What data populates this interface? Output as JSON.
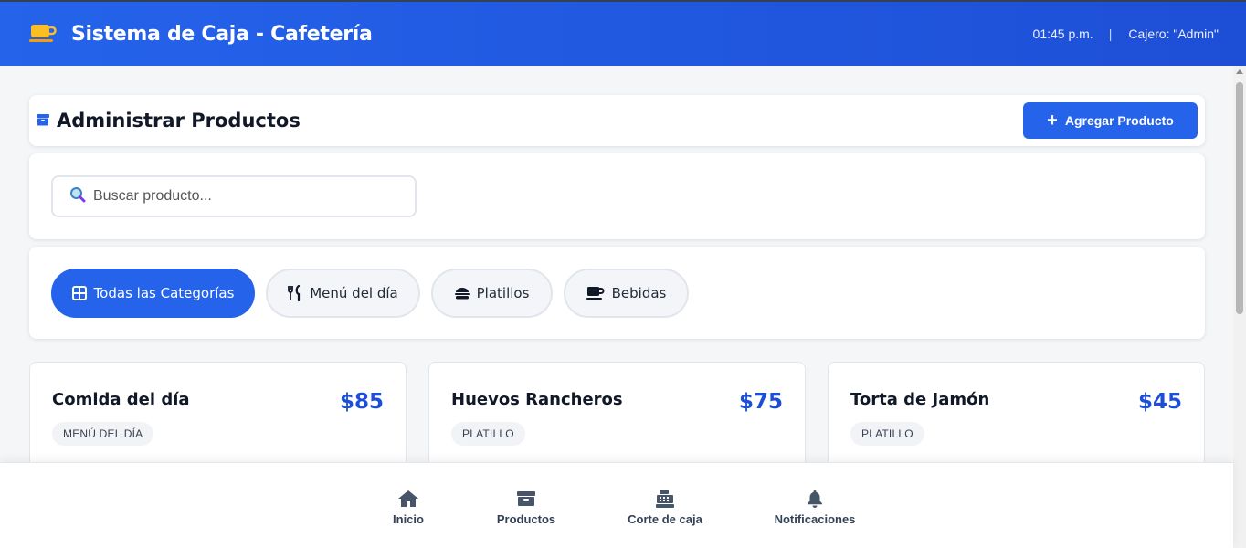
{
  "app": {
    "title": "Sistema de Caja - Cafetería",
    "time": "01:45 p.m.",
    "separator": "|",
    "cashier": "Cajero: \"Admin\""
  },
  "section": {
    "title": "Administrar Productos",
    "add_button": "Agregar Producto"
  },
  "search": {
    "placeholder": "Buscar producto..."
  },
  "categories": [
    {
      "label": "Todas las Categorías",
      "active": true,
      "icon": "grid-icon"
    },
    {
      "label": "Menú del día",
      "active": false,
      "icon": "utensils-icon"
    },
    {
      "label": "Platillos",
      "active": false,
      "icon": "burger-icon"
    },
    {
      "label": "Bebidas",
      "active": false,
      "icon": "mug-icon"
    }
  ],
  "products": [
    {
      "name": "Comida del día",
      "price": "$85",
      "tag": "MENÚ DEL DÍA"
    },
    {
      "name": "Huevos Rancheros",
      "price": "$75",
      "tag": "PLATILLO"
    },
    {
      "name": "Torta de Jamón",
      "price": "$45",
      "tag": "PLATILLO"
    }
  ],
  "nav": [
    {
      "label": "Inicio",
      "icon": "home-icon"
    },
    {
      "label": "Productos",
      "icon": "box-icon"
    },
    {
      "label": "Corte de caja",
      "icon": "cash-register-icon"
    },
    {
      "label": "Notificaciones",
      "icon": "bell-icon"
    }
  ],
  "colors": {
    "primary": "#2563eb",
    "price": "#1d4ed8",
    "background": "#f5f6f8"
  }
}
